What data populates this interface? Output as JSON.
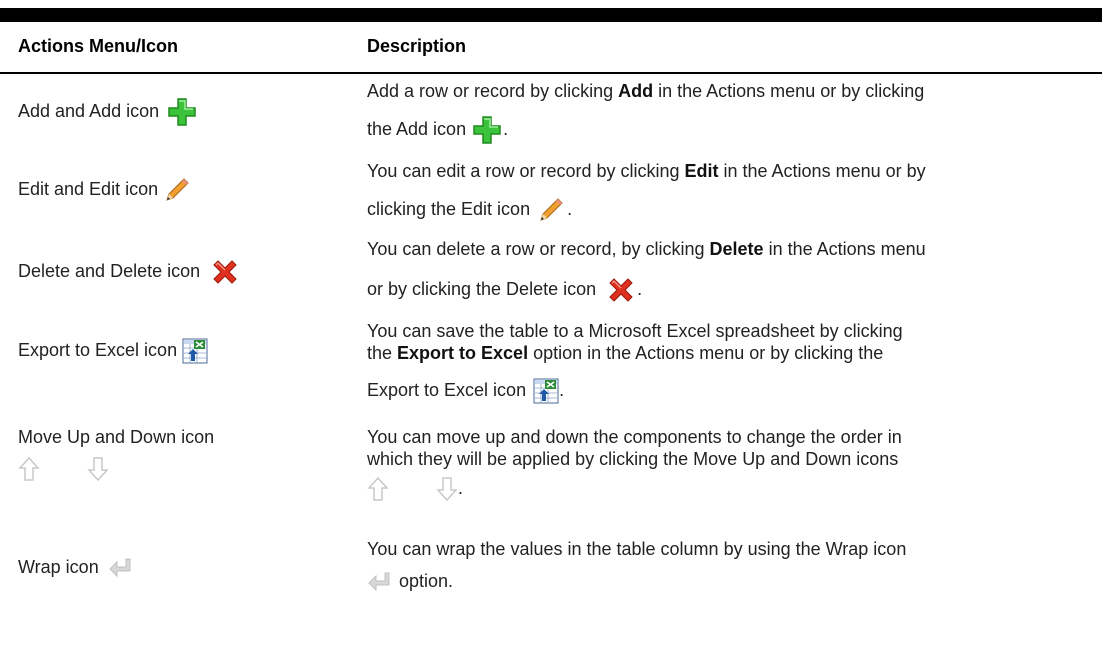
{
  "table": {
    "headers": {
      "action": "Actions Menu/Icon",
      "description": "Description"
    },
    "rows": [
      {
        "action_label": "Add and Add icon",
        "icon": "add-icon",
        "desc_line1_pre": "Add a row or record by clicking ",
        "desc_line1_bold": "Add",
        "desc_line1_post": " in the Actions menu or by clicking",
        "desc_line2": "the Add icon",
        "desc_line2_post": "."
      },
      {
        "action_label": "Edit and Edit icon",
        "icon": "edit-pencil-icon",
        "desc_line1_pre": "You can edit a row or record by clicking ",
        "desc_line1_bold": "Edit",
        "desc_line1_post": " in the Actions menu or by",
        "desc_line2": "clicking the Edit icon",
        "desc_line2_post": "."
      },
      {
        "action_label": "Delete and Delete icon",
        "icon": "delete-icon",
        "desc_line1_pre": "You can delete a row or record, by clicking ",
        "desc_line1_bold": "Delete",
        "desc_line1_post": " in the Actions menu",
        "desc_line2": "or by clicking the Delete icon",
        "desc_line2_post": "."
      },
      {
        "action_label": "Export to Excel icon",
        "icon": "export-excel-icon",
        "desc_line1": "You can save the table to a Microsoft Excel spreadsheet by clicking",
        "desc_line2_pre": "the ",
        "desc_line2_bold": "Export to Excel",
        "desc_line2_post": " option in the Actions menu or by clicking the",
        "desc_line3": "Export to Excel icon",
        "desc_line3_post": "."
      },
      {
        "action_label": "Move Up and Down icon",
        "icon": "move-up-down-icons",
        "desc_line1": "You can move up and down the components to change the order in",
        "desc_line2": "which they will be applied by clicking the Move Up and Down icons",
        "desc_line3_post": "."
      },
      {
        "action_label": "Wrap icon",
        "icon": "wrap-icon",
        "desc_line1": "You can wrap the values in the table column by using the Wrap icon",
        "desc_line2": "option."
      }
    ]
  },
  "colors": {
    "rule": "#000000",
    "add_green": "#3cc33c",
    "delete_red": "#e0301e",
    "pencil_orange": "#f0a030",
    "arrow_gray": "#c8c8c8"
  }
}
